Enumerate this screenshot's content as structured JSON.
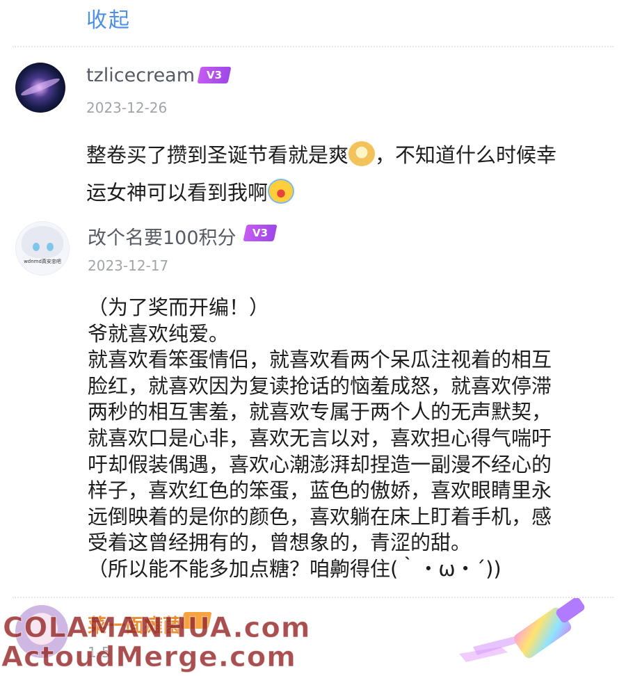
{
  "header": {
    "collapse_label": "收起"
  },
  "comments": [
    {
      "username": "tzlicecream",
      "level_badge": "V3",
      "date": "2023-12-26",
      "text_before_emoji": "整卷买了攒到圣诞节看就是爽",
      "emoji_1": "dog-face-emoji",
      "text_middle_line1": "，不知道什么时候幸",
      "text_middle_line2": "运女神可以看到我啊",
      "emoji_2": "crying-face-emoji"
    },
    {
      "username": "改个名要100积分",
      "level_badge": "V3",
      "date": "2023-12-17",
      "avatar_caption": "wdnmd真安忠吧",
      "lines": [
        "（为了奖而开编！）",
        "爷就喜欢纯爱。",
        "就喜欢看笨蛋情侣，就喜欢看两个呆瓜注视着的相互",
        "脸红，就喜欢因为复读抢话的恼羞成怒，就喜欢停滞",
        "两秒的相互害羞，就喜欢专属于两个人的无声默契，",
        "就喜欢口是心非，喜欢无言以对，喜欢担心得气喘吁",
        "吁却假装偶遇，喜欢心潮澎湃却捏造一副漫不经心的",
        "样子，喜欢红色的笨蛋，蓝色的傲娇，喜欢眼睛里永",
        "远倒映着的是你的颜色，喜欢躺在床上盯着手机，感",
        "受着这曾经拥有的，曾想象的，青涩的甜。",
        "（所以能不能多加点糖？咱齁得住(｀・ω・´))"
      ]
    },
    {
      "username": "菜一面瘫菌",
      "date": "1-5"
    }
  ],
  "watermarks": {
    "line1": "COLAMANHUA.com",
    "line2": "ActoudMerge.com"
  },
  "colors": {
    "link": "#4c8fe6",
    "badge": "#b051ee",
    "date": "#a0a4ab",
    "username": "#555a63"
  }
}
